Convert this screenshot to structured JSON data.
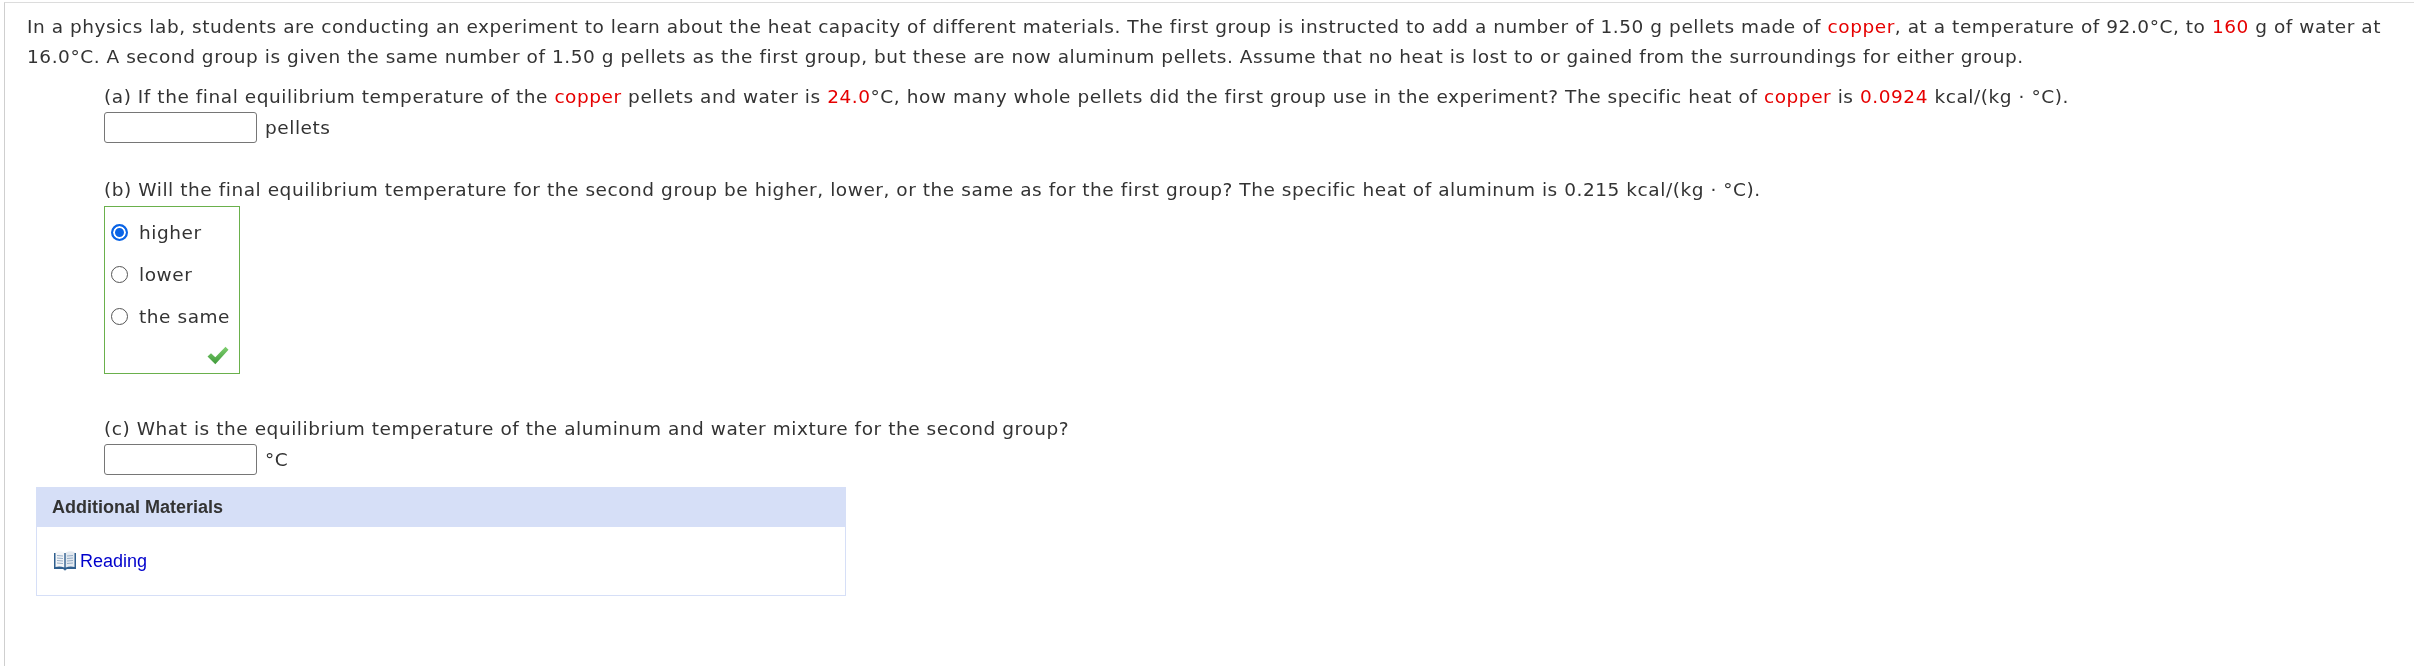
{
  "intro": {
    "segments": [
      {
        "text": "In a physics lab, students are conducting an experiment to learn about the heat capacity of different materials. The first group is instructed to add a number of 1.50 g pellets made of ",
        "highlight": false
      },
      {
        "text": "copper",
        "highlight": true
      },
      {
        "text": ", at a temperature of 92.0°C, to ",
        "highlight": false
      },
      {
        "text": "160",
        "highlight": true
      },
      {
        "text": " g of water at 16.0°C. A second group is given the same number of 1.50 g pellets as the first group, but these are now aluminum pellets. Assume that no heat is lost to or gained from the surroundings for either group.",
        "highlight": false
      }
    ]
  },
  "parts": [
    {
      "kind": "numeric",
      "prompt": [
        {
          "text": "(a) If the final equilibrium temperature of the ",
          "highlight": false
        },
        {
          "text": "copper",
          "highlight": true
        },
        {
          "text": " pellets and water is ",
          "highlight": false
        },
        {
          "text": "24.0",
          "highlight": true
        },
        {
          "text": "°C, how many whole pellets did the first group use in the experiment? The specific heat of ",
          "highlight": false
        },
        {
          "text": "copper",
          "highlight": true
        },
        {
          "text": " is ",
          "highlight": false
        },
        {
          "text": "0.0924",
          "highlight": true
        },
        {
          "text": " kcal/(kg · °C).",
          "highlight": false
        }
      ],
      "answer": {
        "unit": "pellets"
      }
    },
    {
      "kind": "choice",
      "prompt": [
        {
          "text": "(b) Will the final equilibrium temperature for the second group be higher, lower, or the same as for the first group? The specific heat of aluminum is 0.215 kcal/(kg · °C).",
          "highlight": false
        }
      ],
      "correct": true,
      "options": [
        {
          "label": "higher",
          "selected": true
        },
        {
          "label": "lower",
          "selected": false
        },
        {
          "label": "the same",
          "selected": false
        }
      ]
    },
    {
      "kind": "numeric",
      "prompt": [
        {
          "text": "(c) What is the equilibrium temperature of the aluminum and water mixture for the second group?",
          "highlight": false
        }
      ],
      "answer": {
        "unit": "°C"
      }
    }
  ],
  "additional_materials": {
    "title": "Additional Materials",
    "links": [
      {
        "label": "Reading"
      }
    ]
  }
}
